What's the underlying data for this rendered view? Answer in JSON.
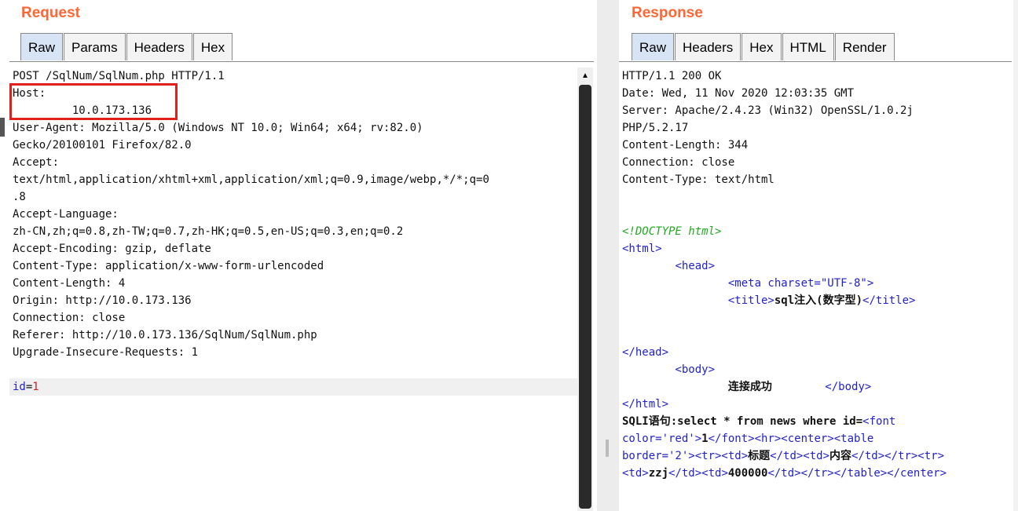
{
  "request": {
    "title": "Request",
    "tabs": [
      "Raw",
      "Params",
      "Headers",
      "Hex"
    ],
    "lines": [
      "POST /SqlNum/SqlNum.php HTTP/1.1",
      "Host:",
      "         10.0.173.136",
      "User-Agent: Mozilla/5.0 (Windows NT 10.0; Win64; x64; rv:82.0)",
      "Gecko/20100101 Firefox/82.0",
      "Accept:",
      "text/html,application/xhtml+xml,application/xml;q=0.9,image/webp,*/*;q=0",
      ".8",
      "Accept-Language:",
      "zh-CN,zh;q=0.8,zh-TW;q=0.7,zh-HK;q=0.5,en-US;q=0.3,en;q=0.2",
      "Accept-Encoding: gzip, deflate",
      "Content-Type: application/x-www-form-urlencoded",
      "Content-Length: 4",
      "Origin: http://10.0.173.136",
      "Connection: close",
      "Referer: http://10.0.173.136/SqlNum/SqlNum.php",
      "Upgrade-Insecure-Requests: 1",
      ""
    ],
    "body_key": "id",
    "body_eq": "=",
    "body_value": "1"
  },
  "response": {
    "title": "Response",
    "tabs": [
      "Raw",
      "Headers",
      "Hex",
      "HTML",
      "Render"
    ],
    "headers": [
      "HTTP/1.1 200 OK",
      "Date: Wed, 11 Nov 2020 12:03:35 GMT",
      "Server: Apache/2.4.23 (Win32) OpenSSL/1.0.2j",
      "PHP/5.2.17",
      "Content-Length: 344",
      "Connection: close",
      "Content-Type: text/html"
    ],
    "doctype": "<!DOCTYPE html>",
    "html_open": "<html>",
    "head_open": "<head>",
    "meta_tag": "<meta charset=\"UTF-8\">",
    "title_open": "<title>",
    "title_text": "sql注入(数字型)",
    "title_close": "</title>",
    "head_close": "</head>",
    "body_open": "<body>",
    "body_text": "连接成功",
    "body_close": "</body>",
    "html_close": "</html>",
    "sql_line_1_text": "SQLI语句:select * from news where id=",
    "sql_line_1_tag": "<font",
    "sql_line_2_attr": "color='red'>",
    "sql_line_2_text": "1",
    "sql_line_2_tags": "</font><hr><center><table",
    "sql_line_3_attr": "border='2'><tr><td>",
    "sql_line_3_t1": "标题",
    "sql_line_3_mid": "</td><td>",
    "sql_line_3_t2": "内容",
    "sql_line_3_tags": "</td></tr><tr>",
    "sql_line_4_open": "<td>",
    "sql_line_4_t1": "zzj",
    "sql_line_4_mid": "</td><td>",
    "sql_line_4_t2": "400000",
    "sql_line_4_tags": "</td></tr></table></center>"
  }
}
